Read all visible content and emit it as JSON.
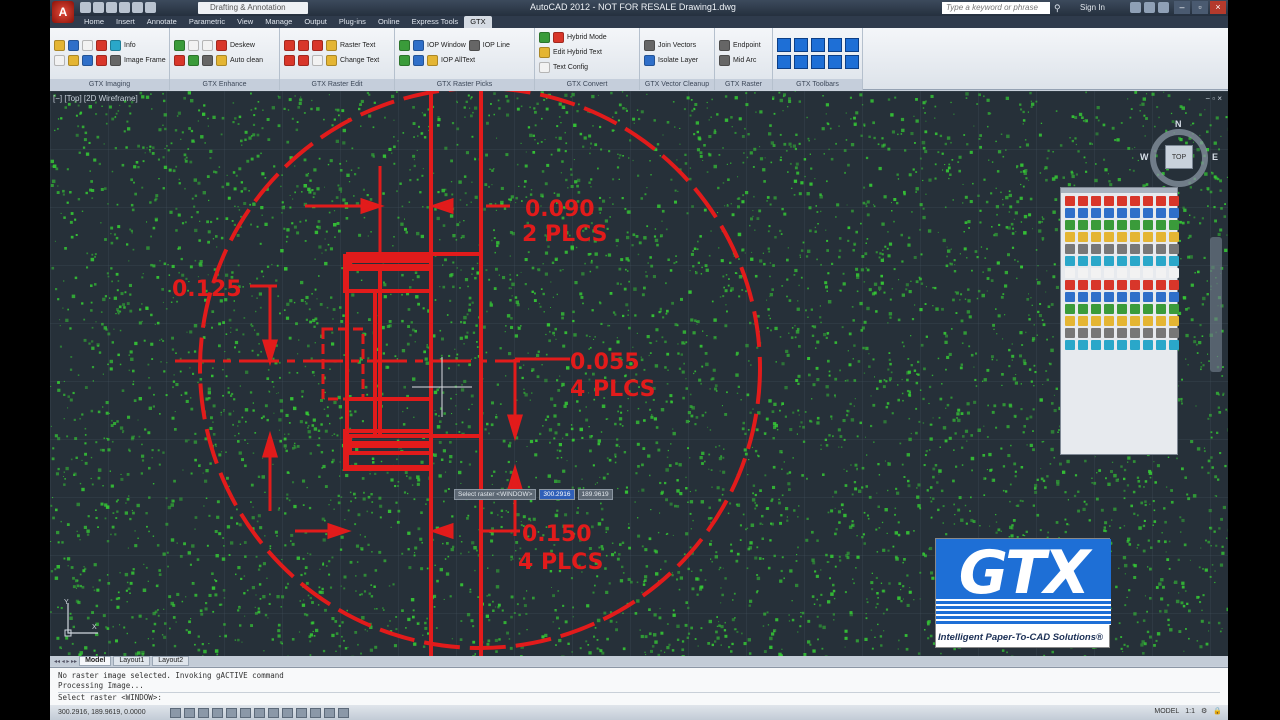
{
  "titlebar": {
    "app_letter": "A",
    "workspace": "Drafting & Annotation",
    "title": "AutoCAD 2012 - NOT FOR RESALE    Drawing1.dwg",
    "search_placeholder": "Type a keyword or phrase",
    "sign_in": "Sign In"
  },
  "ribbon_tabs": [
    "Home",
    "Insert",
    "Annotate",
    "Parametric",
    "View",
    "Manage",
    "Output",
    "Plug-ins",
    "Online",
    "Express Tools",
    "GTX"
  ],
  "ribbon": {
    "imaging": {
      "title": "GTX Imaging",
      "info": "Info",
      "image_frame": "Image Frame"
    },
    "enhance": {
      "title": "GTX Enhance",
      "deskew": "Deskew",
      "auto_clean": "Auto clean"
    },
    "raster_edit": {
      "title": "GTX Raster Edit",
      "raster_text": "Raster Text",
      "change_text": "Change Text"
    },
    "raster_picks": {
      "title": "GTX Raster Picks",
      "iop_window": "IOP Window",
      "iop_line": "IOP Line",
      "iop_alltext": "IOP AllText"
    },
    "convert": {
      "title": "GTX Convert",
      "hybrid_mode": "Hybrid Mode",
      "edit_hybrid_text": "Edit Hybrid Text",
      "text_config": "Text Config"
    },
    "vector_cleanup": {
      "title": "GTX Vector Cleanup",
      "join_vectors": "Join Vectors",
      "isolate_layer": "Isolate Layer"
    },
    "raster_snaps": {
      "title": "GTX Raster Snaps",
      "endpoint": "Endpoint",
      "mid_arc": "Mid Arc"
    },
    "toolbars": {
      "title": "GTX Toolbars"
    }
  },
  "viewport": {
    "label": "[−] [Top] [2D Wireframe]",
    "controls": "− ▫ ×"
  },
  "viewcube": {
    "n": "N",
    "e": "E",
    "w": "W",
    "top": "TOP"
  },
  "drawing_labels": {
    "d1": "0.090",
    "d1b": "2 PLCS",
    "d2": "0.125",
    "d3": "0.055",
    "d3b": "4 PLCS",
    "d4": "0.150",
    "d4b": "4 PLCS"
  },
  "cursor_tip": {
    "prompt": "Select raster <WINDOW>",
    "x": "300.2916",
    "y": "189.9619"
  },
  "logo": {
    "word": "GTX",
    "slogan": "Intelligent Paper-To-CAD Solutions®"
  },
  "ucs": {
    "y": "Y",
    "x": "X"
  },
  "layout_tabs": [
    "Model",
    "Layout1",
    "Layout2"
  ],
  "command": {
    "lines": [
      "No raster image selected.  Invoking gACTIVE command",
      "Processing Image..."
    ],
    "input": "Select raster <WINDOW>:"
  },
  "status": {
    "coords": "300.2916, 189.9619, 0.0000",
    "model": "MODEL",
    "scale": "1:1"
  },
  "colors": {
    "drawing": "#e21b1b",
    "noise": "#35c835",
    "background": "#263039",
    "accent": "#1e6fd6"
  }
}
